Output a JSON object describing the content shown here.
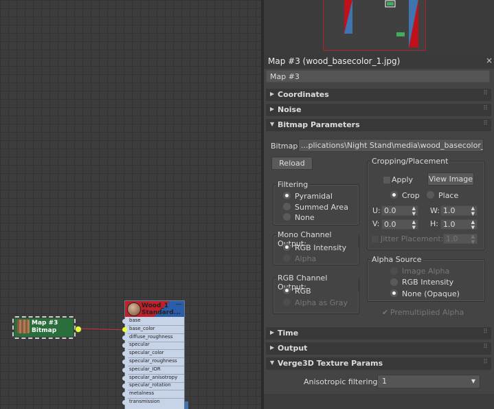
{
  "node_editor": {
    "bitmap_node": {
      "line1": "Map #3",
      "line2": "Bitmap"
    },
    "material_node": {
      "line1": "Wood_1",
      "line2": "Standard...",
      "slots": [
        "base",
        "base_color",
        "diffuse_roughness",
        "specular",
        "specular_color",
        "specular_roughness",
        "specular_IOR",
        "specular_anisotropy",
        "specular_rotation",
        "metalness",
        "transmission"
      ]
    }
  },
  "panel": {
    "title": "Map #3 (wood_basecolor_1.jpg)",
    "close_glyph": "×",
    "name_value": "Map #3",
    "rollouts": {
      "coordinates": "Coordinates",
      "noise": "Noise",
      "bitmap_parameters": "Bitmap Parameters",
      "time": "Time",
      "output": "Output",
      "verge3d": "Verge3D Texture Params"
    },
    "grip_glyph": "⠿",
    "bitmap": {
      "label": "Bitmap:",
      "path": "...plications\\Night Stand\\media\\wood_basecolor_1.jpg",
      "reload": "Reload"
    },
    "filtering": {
      "title": "Filtering",
      "options": [
        "Pyramidal",
        "Summed Area",
        "None"
      ],
      "selected": "Pyramidal"
    },
    "mono_output": {
      "title": "Mono Channel Output:",
      "options": [
        "RGB Intensity",
        "Alpha"
      ],
      "selected": "RGB Intensity"
    },
    "rgb_output": {
      "title": "RGB Channel Output:",
      "options": [
        "RGB",
        "Alpha as Gray"
      ],
      "selected": "RGB"
    },
    "cropping": {
      "title": "Cropping/Placement",
      "apply": "Apply",
      "view_image": "View Image",
      "crop": "Crop",
      "place": "Place",
      "u_label": "U:",
      "u_value": "0.0",
      "v_label": "V:",
      "v_value": "0.0",
      "w_label": "W:",
      "w_value": "1.0",
      "h_label": "H:",
      "h_value": "1.0",
      "jitter_label": "Jitter Placement:",
      "jitter_value": "1.0"
    },
    "alpha_source": {
      "title": "Alpha Source",
      "options": [
        "Image Alpha",
        "RGB Intensity",
        "None (Opaque)"
      ],
      "selected": "None (Opaque)"
    },
    "premultiplied": "Premultiplied Alpha",
    "verge3d": {
      "anisotropic_label": "Anisotropic filtering:",
      "anisotropic_value": "1"
    }
  },
  "colors": {
    "bitmap_node": "#2a6e3c",
    "material_header": "#c0202a",
    "link": "#d8303a",
    "socket_active": "#e8ff30"
  },
  "icons": [
    "close-icon",
    "rollout-arrow-icon",
    "grip-icon",
    "spinner-arrows-icon",
    "dropdown-arrow-icon",
    "wood-thumbnail-icon"
  ]
}
